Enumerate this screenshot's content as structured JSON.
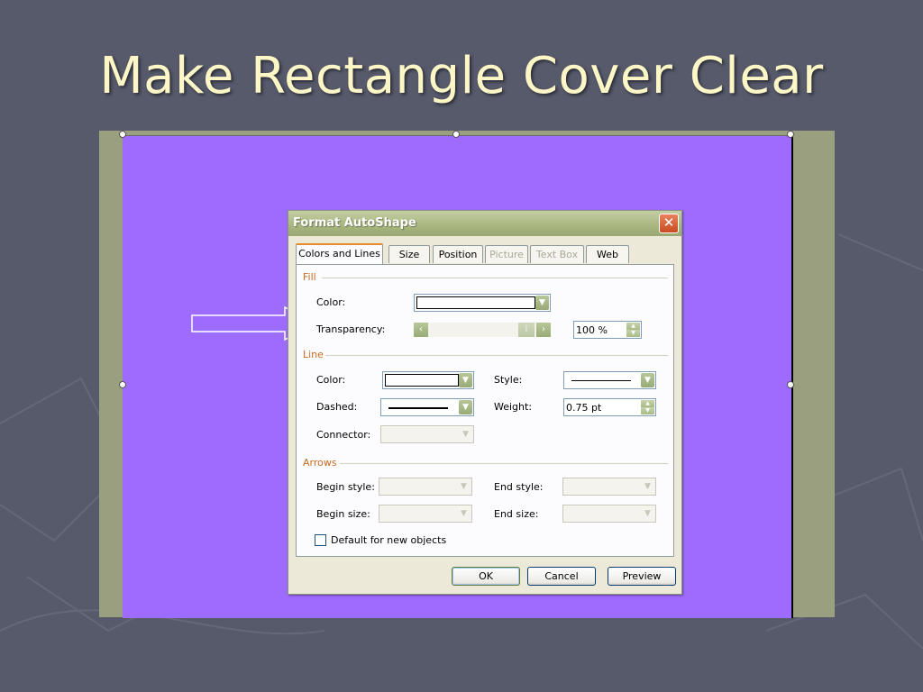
{
  "slide": {
    "title": "Make Rectangle Cover Clear",
    "colors": {
      "background": "#575a6b",
      "title": "#fdf6c6",
      "frame": "#9a9f80",
      "rectangle": "#9e6bff"
    }
  },
  "dialog": {
    "title": "Format AutoShape",
    "close_icon": "close-icon",
    "tabs": [
      {
        "label": "Colors and Lines",
        "active": true,
        "disabled": false
      },
      {
        "label": "Size",
        "active": false,
        "disabled": false
      },
      {
        "label": "Position",
        "active": false,
        "disabled": false
      },
      {
        "label": "Picture",
        "active": false,
        "disabled": true
      },
      {
        "label": "Text Box",
        "active": false,
        "disabled": true
      },
      {
        "label": "Web",
        "active": false,
        "disabled": false
      }
    ],
    "fill": {
      "section": "Fill",
      "color_label": "Color:",
      "transparency_label": "Transparency:",
      "transparency_value": "100 %",
      "transparency_level": 1.0
    },
    "line": {
      "section": "Line",
      "color_label": "Color:",
      "style_label": "Style:",
      "dashed_label": "Dashed:",
      "weight_label": "Weight:",
      "weight_value": "0.75 pt",
      "connector_label": "Connector:"
    },
    "arrows": {
      "section": "Arrows",
      "begin_style_label": "Begin style:",
      "end_style_label": "End style:",
      "begin_size_label": "Begin size:",
      "end_size_label": "End size:"
    },
    "default_checkbox_label": "Default for new objects",
    "buttons": {
      "ok": "OK",
      "cancel": "Cancel",
      "preview": "Preview"
    }
  }
}
